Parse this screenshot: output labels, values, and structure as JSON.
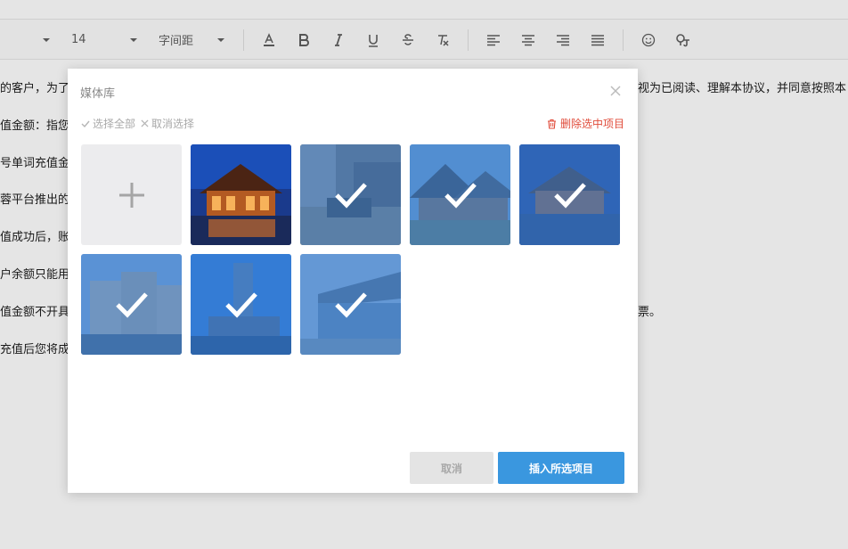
{
  "toolbar": {
    "font_size_value": "14",
    "letter_spacing_label": "字间距",
    "icons": [
      "font-color-icon",
      "bold-icon",
      "italic-icon",
      "underline-icon",
      "strikethrough-icon",
      "clear-format-icon",
      "align-left-icon",
      "align-center-icon",
      "align-right-icon",
      "align-justify-icon",
      "emoji-icon",
      "special-char-icon"
    ]
  },
  "document": {
    "line1_left": "的客户，为了",
    "line1_right": "视为已阅读、理解本协议，并同意按照本",
    "line2": "值金额：指您",
    "line3": "号单词充值金",
    "line4": "蓉平台推出的",
    "line5": "值成功后，账",
    "line6": "户余额只能用",
    "line7_left": "值金额不开具",
    "line7_right": "票。",
    "line8": "充值后您将成"
  },
  "modal": {
    "title": "媒体库",
    "select_all": "选择全部",
    "deselect": "取消选择",
    "delete_selected": "删除选中项目",
    "cancel": "取消",
    "insert": "插入所选项目",
    "tiles": [
      {
        "name": "resort-night-villa",
        "selected": false
      },
      {
        "name": "hotel-lobby",
        "selected": true
      },
      {
        "name": "hotel-wooden-roof",
        "selected": true
      },
      {
        "name": "resort-pool-night",
        "selected": true
      },
      {
        "name": "hotel-building-dusk",
        "selected": true
      },
      {
        "name": "tower-hotel",
        "selected": true
      },
      {
        "name": "glass-pavilion",
        "selected": true
      }
    ]
  },
  "colors": {
    "accent": "#3a97df",
    "danger": "#e04b3a",
    "overlay": "#3a80d4"
  }
}
